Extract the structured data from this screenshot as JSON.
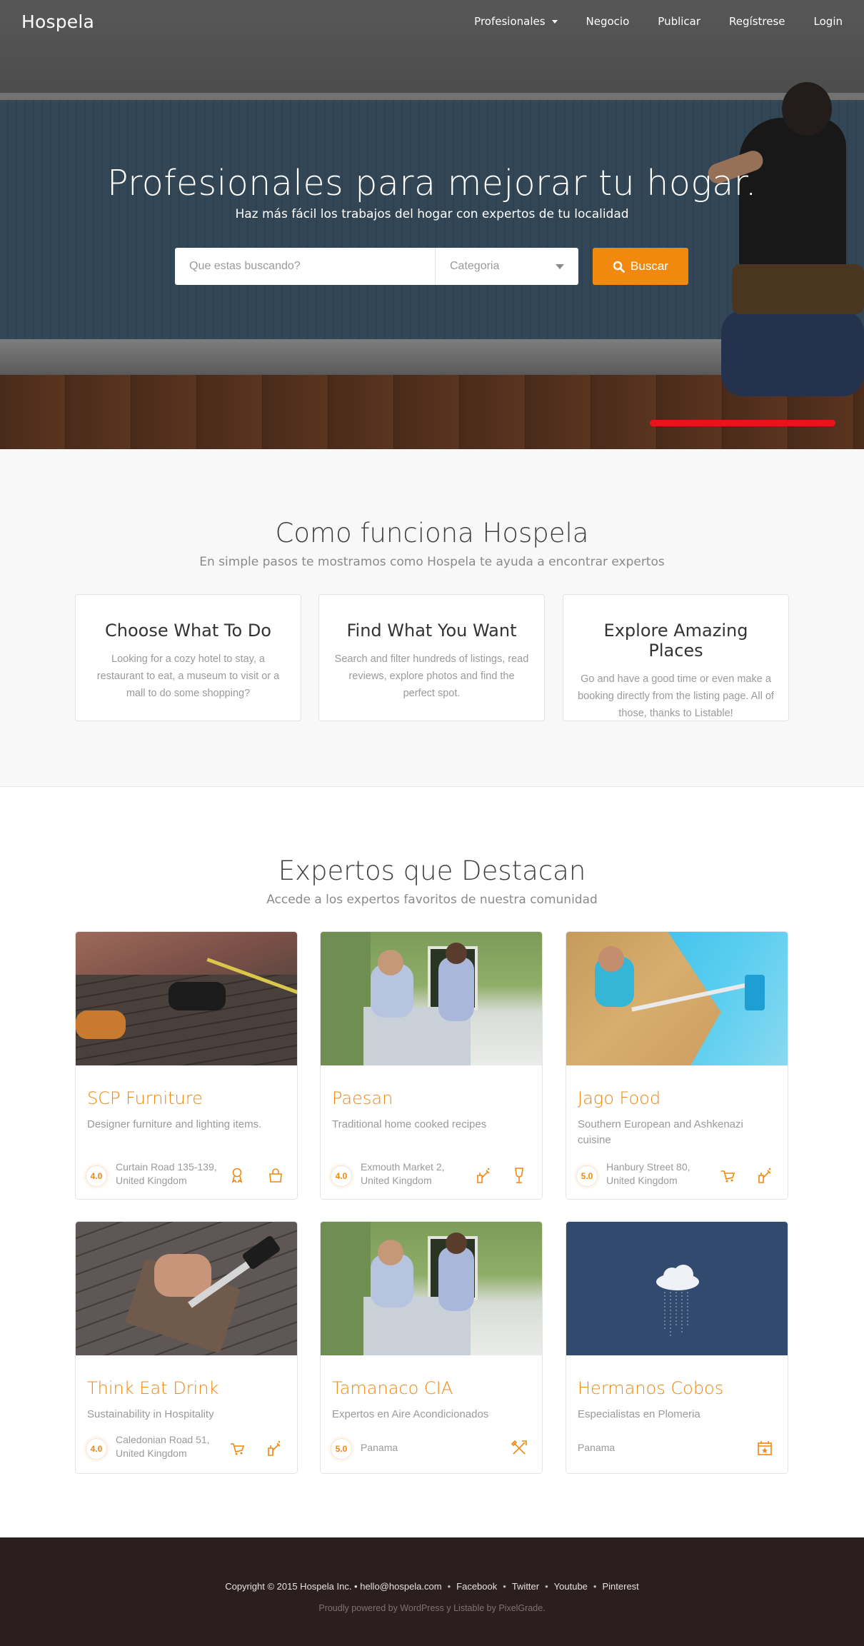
{
  "header": {
    "brand": "Hospela",
    "menu": [
      "Profesionales",
      "Negocio",
      "Publicar",
      "Regístrese",
      "Login"
    ]
  },
  "hero": {
    "title": "Profesionales para mejorar tu hogar.",
    "subtitle": "Haz más fácil los trabajos del hogar con expertos de tu localidad",
    "search_placeholder": "Que estas buscando?",
    "category_placeholder": "Categoria",
    "search_button": "Buscar"
  },
  "how": {
    "title": "Como funciona Hospela",
    "subtitle": "En simple pasos te mostramos como Hospela te ayuda a encontrar expertos",
    "steps": [
      {
        "title": "Choose What To Do",
        "text": "Looking for a cozy hotel to stay, a restaurant to eat, a museum to visit or a mall to do some shopping?"
      },
      {
        "title": "Find What You Want",
        "text": "Search and filter hundreds of listings, read reviews, explore photos and find the perfect spot."
      },
      {
        "title": "Explore Amazing Places",
        "text": "Go and have a good time or even make a booking directly from the listing page. All of those, thanks to Listable!"
      }
    ]
  },
  "experts": {
    "title": "Expertos que Destacan",
    "subtitle": "Accede a los expertos favoritos de nuestra comunidad",
    "cards": [
      {
        "title": "SCP Furniture",
        "desc": "Designer furniture and lighting items.",
        "rating": "4.0",
        "address": "Curtain Road 135-139, United Kingdom",
        "icons": [
          "award-icon",
          "shopping-bag-icon"
        ]
      },
      {
        "title": "Paesan",
        "desc": "Traditional home cooked recipes",
        "rating": "4.0",
        "address": "Exmouth Market 2, United Kingdom",
        "icons": [
          "cleaning-icon",
          "wine-glass-icon"
        ]
      },
      {
        "title": "Jago Food",
        "desc": "Southern European and Ashkenazi cuisine",
        "rating": "5.0",
        "address": "Hanbury Street 80, United Kingdom",
        "icons": [
          "cart-icon",
          "cleaning-icon"
        ]
      },
      {
        "title": "Think Eat Drink",
        "desc": "Sustainability in Hospitality",
        "rating": "4.0",
        "address": "Caledonian Road 51, United Kingdom",
        "icons": [
          "cart-icon",
          "cleaning-icon"
        ]
      },
      {
        "title": "Tamanaco CIA",
        "desc": "Expertos en Aire Acondicionados",
        "rating": "5.0",
        "address": "Panama",
        "icons": [
          "tools-icon"
        ]
      },
      {
        "title": "Hermanos Cobos",
        "desc": "Especialistas en Plomeria",
        "rating": "",
        "address": "Panama",
        "icons": [
          "calendar-star-icon"
        ]
      }
    ]
  },
  "footer": {
    "copyright": "Copyright © 2015 Hospela Inc. • hello@hospela.com",
    "links": [
      "Facebook",
      "Twitter",
      "Youtube",
      "Pinterest"
    ],
    "powered": "Proudly powered by WordPress y Listable by PixelGrade."
  },
  "colors": {
    "accent": "#f2890f",
    "footer": "#2b1e1f",
    "highlight_bar": "#e8131b"
  }
}
